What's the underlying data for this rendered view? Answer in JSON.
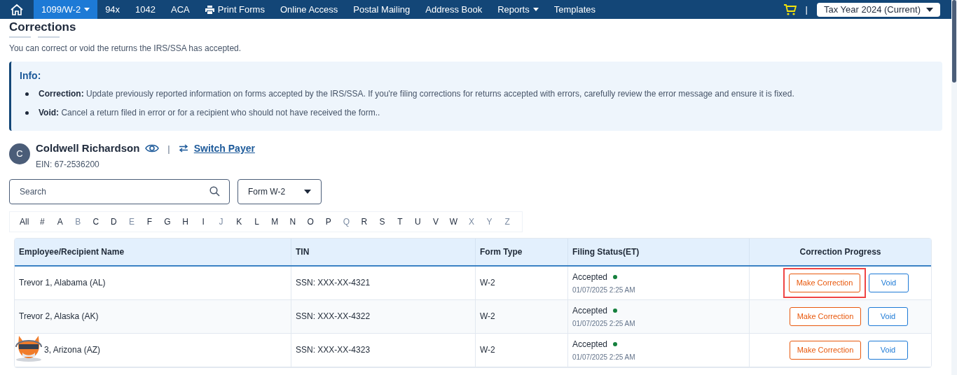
{
  "nav": {
    "items": [
      {
        "label": "1099/W-2",
        "selected": true,
        "kind": "dropdown"
      },
      {
        "label": "94x",
        "selected": false,
        "kind": "link"
      },
      {
        "label": "1042",
        "selected": false,
        "kind": "link"
      },
      {
        "label": "ACA",
        "selected": false,
        "kind": "link"
      },
      {
        "label": "Print Forms",
        "selected": false,
        "kind": "print"
      },
      {
        "label": "Online Access",
        "selected": false,
        "kind": "link"
      },
      {
        "label": "Postal Mailing",
        "selected": false,
        "kind": "link"
      },
      {
        "label": "Address Book",
        "selected": false,
        "kind": "link"
      },
      {
        "label": "Reports",
        "selected": false,
        "kind": "dropdown"
      },
      {
        "label": "Templates",
        "selected": false,
        "kind": "link"
      }
    ],
    "separator": "|",
    "tax_year": "Tax Year 2024 (Current)"
  },
  "page": {
    "title": "Corrections",
    "subtitle": "You can correct or void the returns the IRS/SSA has accepted."
  },
  "info": {
    "title": "Info:",
    "items": [
      "**Correction:** Update previously reported information on forms accepted by the IRS/SSA. If you're filing corrections for returns accepted with errors, carefully review the error message and ensure it is fixed.",
      "**Void:** Cancel a return filed in error or for a recipient who should not have received the form.."
    ]
  },
  "payer": {
    "initial": "C",
    "name": "Coldwell Richardson",
    "separator": "|",
    "switch_label": "Switch Payer",
    "ein": "EIN: 67-2536200"
  },
  "search": {
    "placeholder": "Search"
  },
  "form_select": {
    "value": "Form W-2"
  },
  "letters": [
    {
      "label": "All",
      "disabled": false
    },
    {
      "label": "#",
      "disabled": false
    },
    {
      "label": "A",
      "disabled": false
    },
    {
      "label": "B",
      "disabled": true
    },
    {
      "label": "C",
      "disabled": false
    },
    {
      "label": "D",
      "disabled": false
    },
    {
      "label": "E",
      "disabled": true
    },
    {
      "label": "F",
      "disabled": false
    },
    {
      "label": "G",
      "disabled": false
    },
    {
      "label": "H",
      "disabled": false
    },
    {
      "label": "I",
      "disabled": false
    },
    {
      "label": "J",
      "disabled": true
    },
    {
      "label": "K",
      "disabled": false
    },
    {
      "label": "L",
      "disabled": false
    },
    {
      "label": "M",
      "disabled": false
    },
    {
      "label": "N",
      "disabled": false
    },
    {
      "label": "O",
      "disabled": false
    },
    {
      "label": "P",
      "disabled": false
    },
    {
      "label": "Q",
      "disabled": true
    },
    {
      "label": "R",
      "disabled": false
    },
    {
      "label": "S",
      "disabled": false
    },
    {
      "label": "T",
      "disabled": false
    },
    {
      "label": "U",
      "disabled": false
    },
    {
      "label": "V",
      "disabled": false
    },
    {
      "label": "W",
      "disabled": false
    },
    {
      "label": "X",
      "disabled": true
    },
    {
      "label": "Y",
      "disabled": true
    },
    {
      "label": "Z",
      "disabled": true
    }
  ],
  "table": {
    "columns": [
      "Employee/Recipient Name",
      "TIN",
      "Form Type",
      "Filing Status(ET)",
      "Correction Progress"
    ],
    "rows": [
      {
        "name": "Trevor 1, Alabama (AL)",
        "tin": "SSN: XXX-XX-4321",
        "form_type": "W-2",
        "status": "Accepted",
        "color": "#15803d",
        "date": "01/07/2025 2:25 AM",
        "correction_label": "Make Correction",
        "void_label": "Void",
        "highlighted": true,
        "covered": false
      },
      {
        "name": "Trevor 2, Alaska (AK)",
        "tin": "SSN: XXX-XX-4322",
        "form_type": "W-2",
        "status": "Accepted",
        "color": "#15803d",
        "date": "01/07/2025 2:25 AM",
        "correction_label": "Make Correction",
        "void_label": "Void",
        "highlighted": false,
        "covered": false
      },
      {
        "name": "3, Arizona (AZ)",
        "tin": "SSN: XXX-XX-4323",
        "form_type": "W-2",
        "status": "Accepted",
        "color": "#15803d",
        "date": "01/07/2025 2:25 AM",
        "correction_label": "Make Correction",
        "void_label": "Void",
        "highlighted": false,
        "covered": true
      }
    ]
  }
}
